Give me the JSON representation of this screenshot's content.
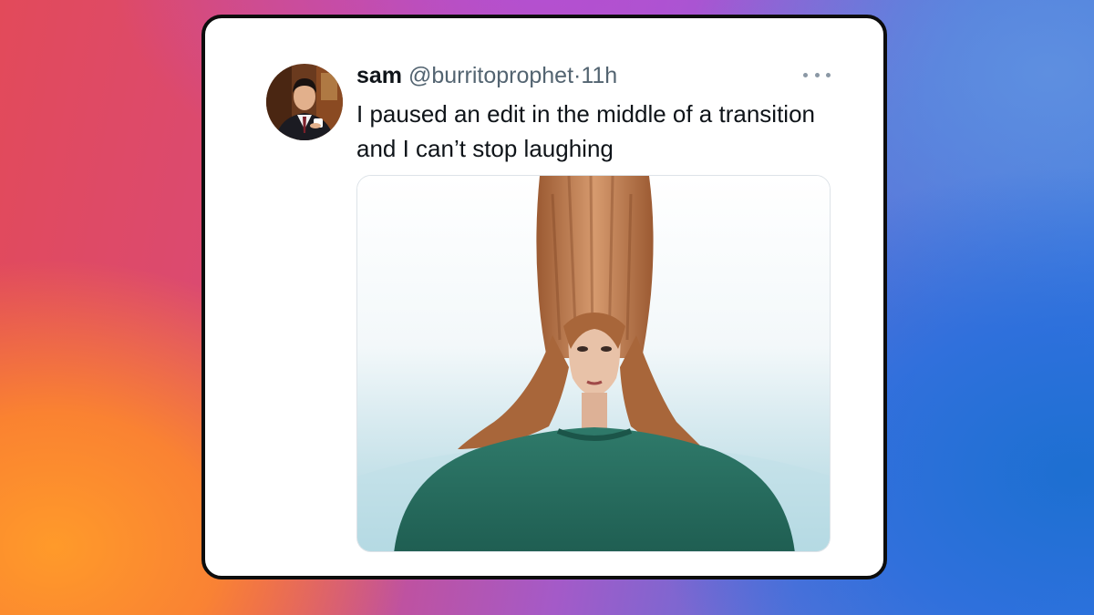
{
  "tweet": {
    "display_name": "sam",
    "handle": "@burritoprophet",
    "separator": "·",
    "time": "11h",
    "text": "I paused an edit in the middle of a transition and I can’t stop laughing"
  },
  "icons": {
    "more": "more-horizontal-icon"
  },
  "colors": {
    "card_background": "#ffffff",
    "card_border": "#0d0d0d",
    "primary_text": "#0f1419",
    "secondary_text": "#536471"
  }
}
